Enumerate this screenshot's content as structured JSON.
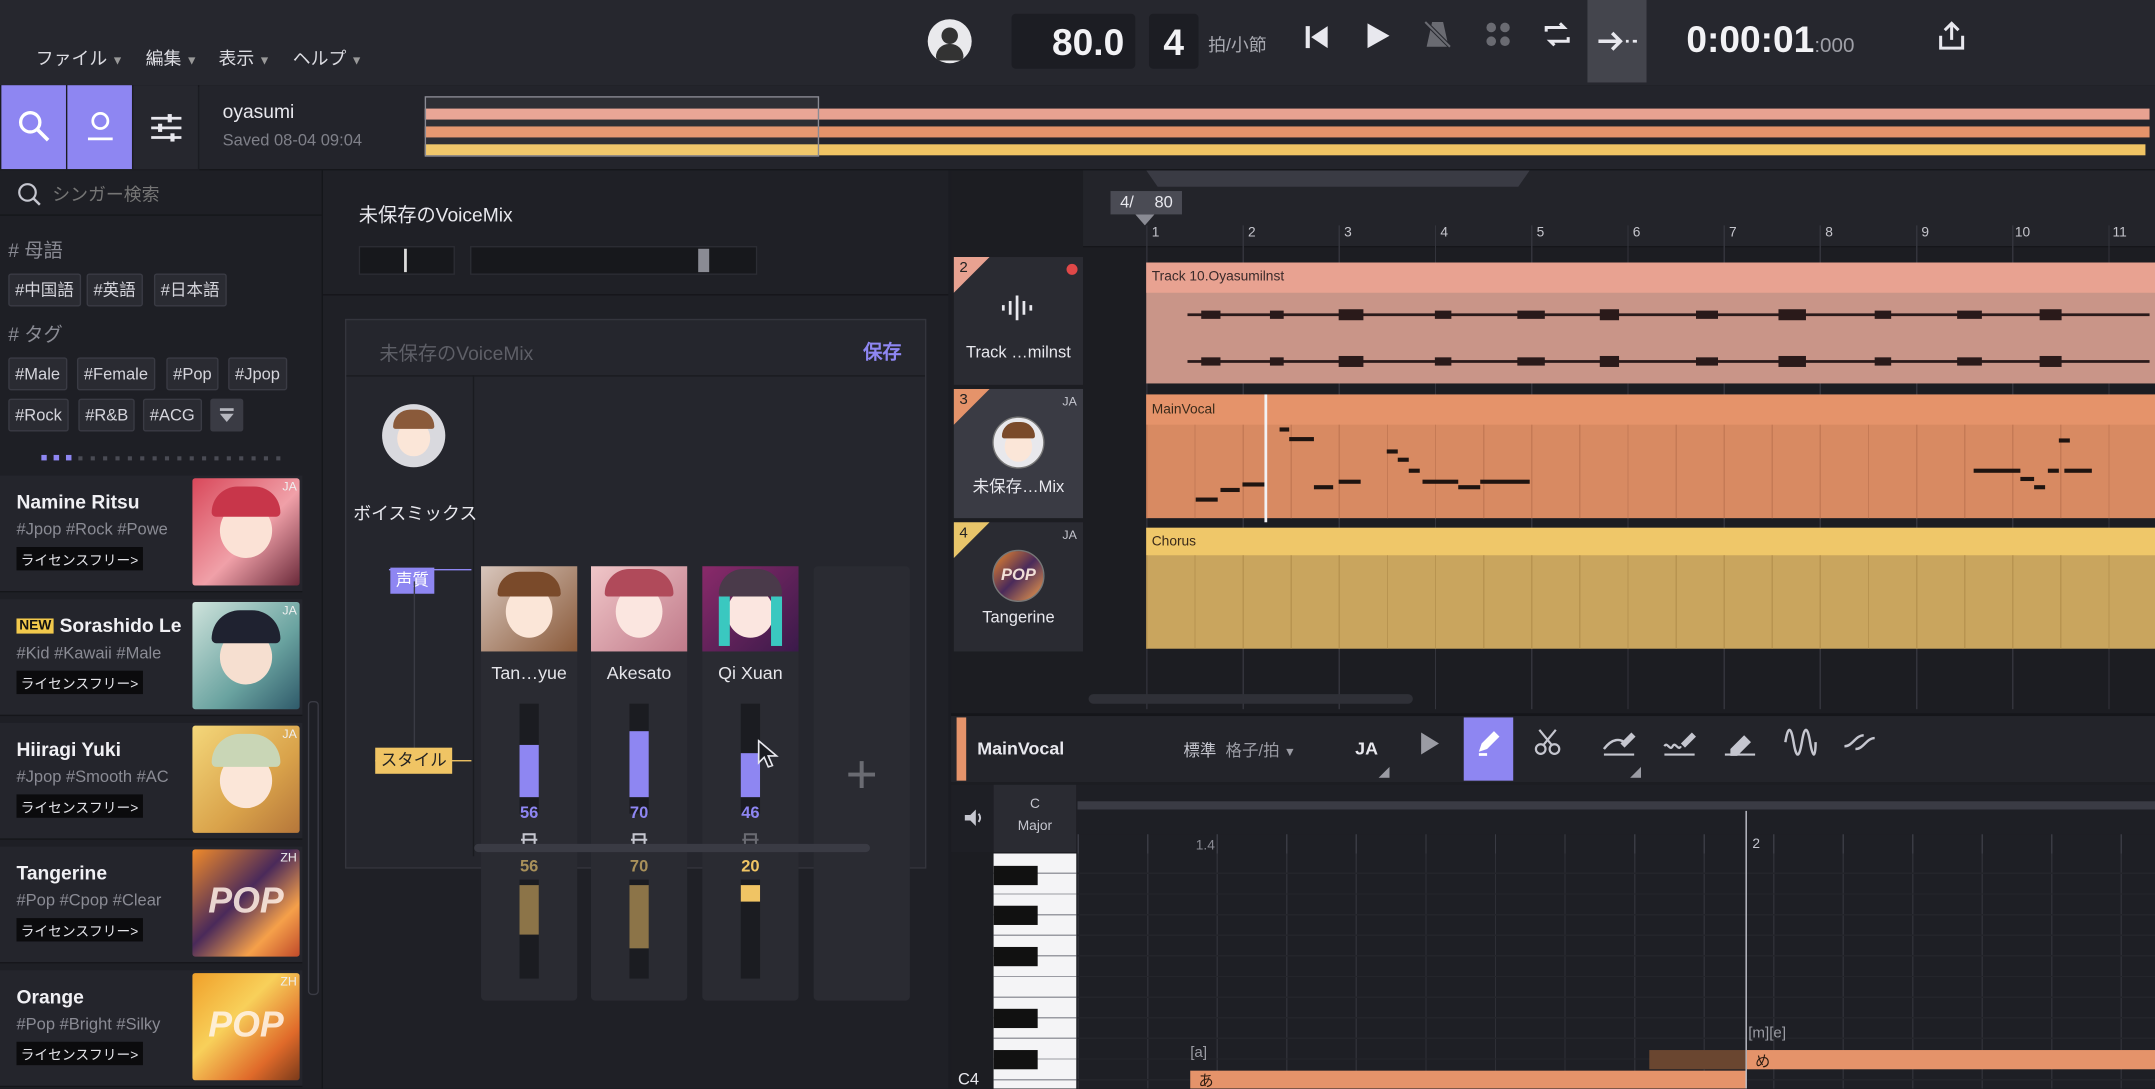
{
  "menu": [
    "ファイル",
    "編集",
    "表示",
    "ヘルプ"
  ],
  "transport": {
    "tempo": "80.0",
    "beats": "4",
    "beats_unit": "拍/小節",
    "time": "0:00:01",
    "time_ms": ":000"
  },
  "project": {
    "name": "oyasumi",
    "saved": "Saved 08-04 09:04"
  },
  "search": {
    "placeholder": "シンガー検索"
  },
  "filters": {
    "mother_heading": "# 母語",
    "mother_tags": [
      "#中国語",
      "#英語",
      "#日本語"
    ],
    "tag_heading": "# タグ",
    "tags_row1": [
      "#Male",
      "#Female",
      "#Pop",
      "#Jpop"
    ],
    "tags_row2": [
      "#Rock",
      "#R&B",
      "#ACG"
    ]
  },
  "singers": [
    {
      "name": "Namine Ritsu",
      "tags": "#Jpop #Rock #Powe",
      "license": "ライセンスフリー>",
      "lang": "JA",
      "new": ""
    },
    {
      "name": "Sorashido Le",
      "tags": "#Kid #Kawaii #Male",
      "license": "ライセンスフリー>",
      "lang": "JA",
      "new": "NEW"
    },
    {
      "name": "Hiiragi Yuki",
      "tags": "#Jpop #Smooth #AC",
      "license": "ライセンスフリー>",
      "lang": "JA",
      "new": ""
    },
    {
      "name": "Tangerine",
      "tags": "#Pop #Cpop #Clear",
      "license": "ライセンスフリー>",
      "lang": "ZH",
      "new": "",
      "logo": "POP"
    },
    {
      "name": "Orange",
      "tags": "#Pop #Bright #Silky",
      "license": "ライセンスフリー>",
      "lang": "ZH",
      "new": "",
      "logo": "POP"
    }
  ],
  "voicemix": {
    "title": "未保存のVoiceMix",
    "inner_title": "未保存のVoiceMix",
    "save": "保存",
    "mix_label": "ボイスミックス",
    "quality_label": "声質",
    "style_label": "スタイル",
    "add": "+",
    "columns": [
      {
        "name": "Tan…yue",
        "quality": "56",
        "style": "56",
        "q_level": 0.56,
        "s_level": 0.56
      },
      {
        "name": "Akesato",
        "quality": "70",
        "style": "70",
        "q_level": 0.7,
        "s_level": 0.7
      },
      {
        "name": "Qi Xuan",
        "quality": "46",
        "style": "20",
        "q_level": 0.46,
        "s_level": 0.2
      }
    ]
  },
  "timeline": {
    "signature": "4/",
    "tempo": "80",
    "bars": [
      "1",
      "2",
      "3",
      "4",
      "5",
      "6",
      "7",
      "8",
      "9",
      "10",
      "11"
    ]
  },
  "tracks": [
    {
      "num": "2",
      "name": "Track …milnst",
      "clip": "Track 10.Oyasumilnst",
      "lang": ""
    },
    {
      "num": "3",
      "name": "未保存…Mix",
      "clip": "MainVocal",
      "lang": "JA"
    },
    {
      "num": "4",
      "name": "Tangerine",
      "clip": "Chorus",
      "lang": "JA",
      "logo": "POP"
    }
  ],
  "editor": {
    "track": "MainVocal",
    "quant_label": "標準",
    "quant_value": "格子/拍",
    "lang": "JA",
    "key_root": "C",
    "key_mode": "Major",
    "ruler": [
      "1.4",
      "2"
    ],
    "note_label": "C4",
    "phoneme1": "[a]",
    "lyric1": "あ",
    "phoneme2": "[m][e]",
    "lyric2": "め"
  },
  "colors": {
    "accent": "#8e86f2",
    "track2": "#e8a291",
    "track3": "#e5936a",
    "track4": "#e8c56a"
  }
}
